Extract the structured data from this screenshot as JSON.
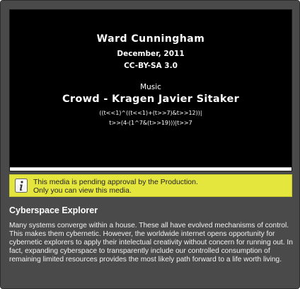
{
  "video": {
    "author": "Ward Cunningham",
    "date": "December, 2011",
    "license": "CC-BY-SA 3.0",
    "music_label": "Music",
    "track": "Crowd - Kragen Javier Sitaker",
    "code_line_1": "((t<<1)^((t<<1)+(t>>7)&t>>12))|",
    "code_line_2": "t>>(4-(1^7&(t>>19)))|t>>7"
  },
  "notice": {
    "icon": "info-icon",
    "line1": "This media is pending approval by the Production.",
    "line2": "Only you can view this media.",
    "background_color": "#e5e63d"
  },
  "media": {
    "title": "Cyberspace Explorer",
    "description": "Many systems converge within a house. These all have evolved mechanisms of control. This makes them cybernetic. However, the worldwide internet opens opportunity for cybernetic explorers to apply their intelectual creativity without concern for running out. In fact, expanding cyberspace to transparently include our controlled consumption of remaining limited resources provides the most likely path forward to a life worth living."
  }
}
